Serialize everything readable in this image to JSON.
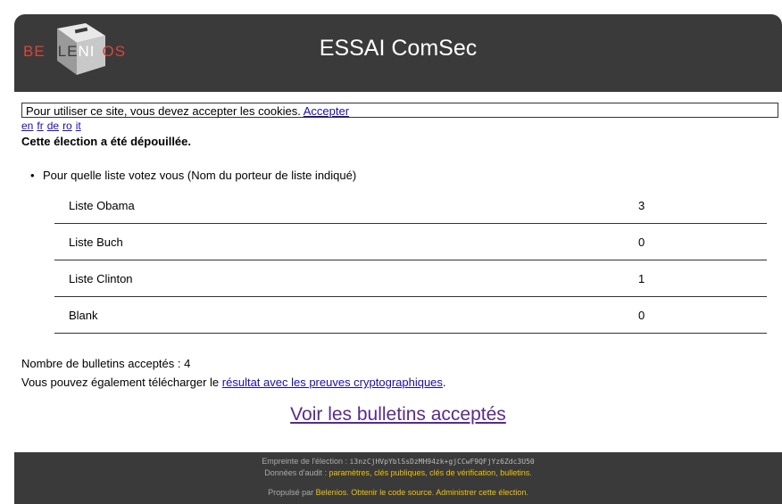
{
  "header": {
    "logo_text": "BELENIOS",
    "title": "ESSAI ComSec"
  },
  "cookie": {
    "message": "Pour utiliser ce site, vous devez accepter les cookies.",
    "accept_label": "Accepter"
  },
  "languages": [
    "en",
    "fr",
    "de",
    "ro",
    "it"
  ],
  "status": "Cette élection a été dépouillée.",
  "question": "Pour quelle liste votez vous (Nom du porteur de liste indiqué)",
  "results": [
    {
      "label": "Liste Obama",
      "count": "3"
    },
    {
      "label": "Liste Buch",
      "count": "0"
    },
    {
      "label": "Liste Clinton",
      "count": "1"
    },
    {
      "label": "Blank",
      "count": "0"
    }
  ],
  "accepted_text": "Nombre de bulletins acceptés : 4",
  "download": {
    "prefix": "Vous pouvez également télécharger le",
    "link": "résultat avec les preuves cryptographiques",
    "suffix": "."
  },
  "view_ballots_label": "Voir les bulletins acceptés",
  "footer": {
    "fingerprint_label": "Empreinte de l'élection :",
    "fingerprint": "i3nzCjHVpYblSsDzMH94zk+gjCCwF9QFjYz6Zdc3U50",
    "audit_label": "Données d'audit :",
    "audit_links": [
      "paramètres",
      "clés publiques",
      "clés de vérification",
      "bulletins"
    ],
    "powered_label": "Propulsé par",
    "powered_link": "Belenios",
    "source_link": "Obtenir le code source",
    "admin_link": "Administrer cette élection"
  },
  "colors": {
    "header_bg": "#3a3a3a",
    "logo_red": "#d8463a",
    "footer_link": "#f2c200",
    "visited_link": "#5a2a8a"
  }
}
